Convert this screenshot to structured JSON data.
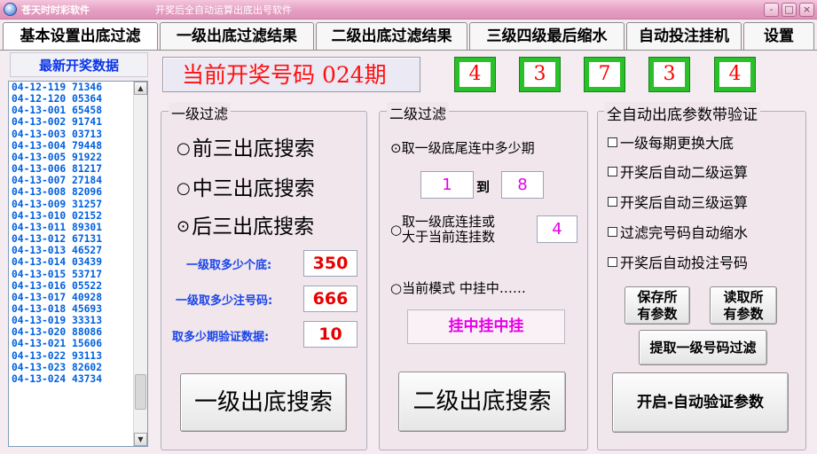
{
  "window": {
    "title": "苍天时时彩软件",
    "subtitle": "开奖后全自动运算出底出号软件",
    "controls": [
      "-",
      "□",
      "×"
    ]
  },
  "tabs": [
    "基本设置出底过滤",
    "一级出底过滤结果",
    "二级出底过滤结果",
    "三级四级最后缩水",
    "自动投注挂机",
    "设置"
  ],
  "latest": {
    "title": "最新开奖数据",
    "rows": [
      "04-12-119 71346",
      "04-12-120 05364",
      "04-13-001 65458",
      "04-13-002 91741",
      "04-13-003 03713",
      "04-13-004 79448",
      "04-13-005 91922",
      "04-13-006 81217",
      "04-13-007 27184",
      "04-13-008 82096",
      "04-13-009 31257",
      "04-13-010 02152",
      "04-13-011 89301",
      "04-13-012 67131",
      "04-13-013 46527",
      "04-13-014 03439",
      "04-13-015 53717",
      "04-13-016 05522",
      "04-13-017 40928",
      "04-13-018 45693",
      "04-13-019 33313",
      "04-13-020 88086",
      "04-13-021 15606",
      "04-13-022 93113",
      "04-13-023 82602",
      "04-13-024 43734"
    ]
  },
  "current": {
    "text": "当前开奖号码 024期",
    "digits": [
      "4",
      "3",
      "7",
      "3",
      "4"
    ]
  },
  "level1": {
    "legend": "一级过滤",
    "options": [
      "前三出底搜索",
      "中三出底搜索",
      "后三出底搜索"
    ],
    "fields": [
      {
        "label": "一级取多少个底:",
        "value": "350"
      },
      {
        "label": "一级取多少注号码:",
        "value": "666"
      },
      {
        "label": "取多少期验证数据:",
        "value": "10"
      }
    ],
    "search_button": "一级出底搜索"
  },
  "level2": {
    "legend": "二级过滤",
    "option1": "取一级底尾连中多少期",
    "range_from": "1",
    "range_to_label": "到",
    "range_to": "8",
    "option2_line1": "取一级底连挂或",
    "option2_line2": "大于当前连挂数",
    "option2_value": "4",
    "option3": "当前模式  中挂中……",
    "mode_value": "挂中挂中挂",
    "search_button": "二级出底搜索"
  },
  "auto": {
    "legend": "全自动出底参数带验证",
    "checks": [
      "一级每期更换大底",
      "开奖后自动二级运算",
      "开奖后自动三级运算",
      "过滤完号码自动缩水",
      "开奖后自动投注号码"
    ],
    "save_line1": "保存所",
    "save_line2": "有参数",
    "load_line1": "读取所",
    "load_line2": "有参数",
    "extract_button": "提取一级号码过滤",
    "start_button": "开启-自动验证参数"
  }
}
